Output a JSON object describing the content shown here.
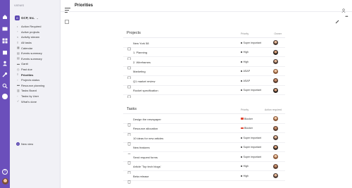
{
  "sidebar": {
    "heading": "VIEWS",
    "workspace": {
      "badge": "G",
      "name": "GCP, Inc.",
      "chevron": "⌄"
    },
    "items": [
      {
        "label": "Action Required",
        "icon": "bell-icon"
      },
      {
        "label": "Active projects",
        "icon": "folder-icon"
      },
      {
        "label": "Activity stream",
        "icon": "stream-icon"
      },
      {
        "label": "All tasks",
        "icon": "tasks-icon"
      },
      {
        "label": "Calendar",
        "icon": "calendar-icon"
      },
      {
        "label": "Events summary",
        "icon": "summary-icon"
      },
      {
        "label": "Events summary",
        "icon": "summary-icon"
      },
      {
        "label": "Gantt",
        "icon": "gantt-icon"
      },
      {
        "label": "Past due",
        "icon": "clock-icon"
      },
      {
        "label": "Priorities",
        "icon": "priorities-icon",
        "active": true
      },
      {
        "label": "Projects status",
        "icon": "status-icon"
      },
      {
        "label": "Resource planning",
        "icon": "resource-icon"
      },
      {
        "label": "Tasks Board",
        "icon": "board-icon"
      },
      {
        "label": "Tasks by User",
        "icon": "user-icon"
      },
      {
        "label": "What's done",
        "icon": "check-icon"
      }
    ],
    "new_view": "New view"
  },
  "header": {
    "title": "Priorities"
  },
  "projects": {
    "title": "Projects",
    "col_priority": "Priority",
    "col_owner": "Owner",
    "rows": [
      {
        "name": "New York 58",
        "priority": "Super important"
      },
      {
        "name": "1. Planning",
        "priority": "High"
      },
      {
        "name": "2. Wireframes",
        "priority": "High"
      },
      {
        "name": "Marketing",
        "priority": "ASAP"
      },
      {
        "name": "Q1 market review",
        "priority": "ASAP"
      },
      {
        "name": "Rocket specification",
        "priority": "Super important"
      }
    ]
  },
  "tasks": {
    "title": "Tasks",
    "col_priority": "Priority",
    "col_action": "Action required",
    "rows": [
      {
        "name": "Design the newspaper",
        "priority": "Blocker"
      },
      {
        "name": "Resource allocation",
        "priority": "Blocker"
      },
      {
        "name": "10 ideas for new articles",
        "priority": "Super important"
      },
      {
        "name": "New features",
        "priority": "Super important"
      },
      {
        "name": "Send request forms",
        "priority": "Super important"
      },
      {
        "name": "Article 'Top tech blogs'",
        "priority": "High"
      },
      {
        "name": "Beta release",
        "priority": "High"
      }
    ]
  },
  "colors": {
    "rail": "#6b4fbb",
    "accent": "#5b47b1",
    "blocker": "#e2442f"
  }
}
